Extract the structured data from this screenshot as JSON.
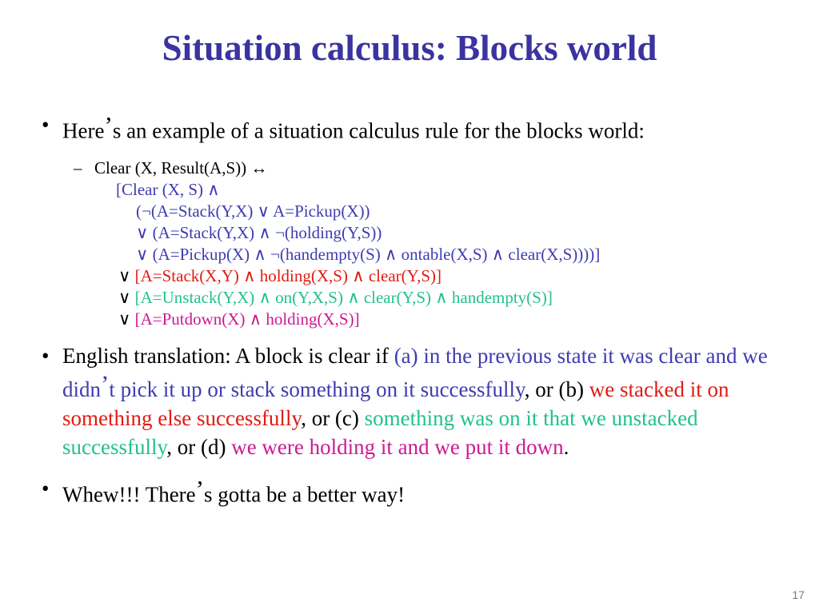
{
  "slide": {
    "title": "Situation calculus: Blocks world",
    "page_number": "17",
    "colors": {
      "title": "#3a33a0",
      "blue": "#3f3cb0",
      "red": "#e01b12",
      "green": "#24c08d",
      "magenta": "#cc1a92",
      "black": "#000000",
      "page_number": "#7a7a7a",
      "background": "#ffffff"
    },
    "bullet_marker": "•",
    "dash_marker": "–",
    "apostrophe": "’"
  },
  "bullet1": {
    "text_before_apos": "Here",
    "text_after_apos": "s an example of a situation calculus rule for the blocks world:"
  },
  "formula": {
    "head": "Clear (X, Result(A,S)) ↔",
    "lines": [
      {
        "indent": "ind-1",
        "op": "",
        "body": "[Clear (X, S) ∧",
        "color": "c-blue"
      },
      {
        "indent": "ind-2",
        "op": "",
        "body": "(¬(A=Stack(Y,X) ∨ A=Pickup(X))",
        "color": "c-blue"
      },
      {
        "indent": "ind-2",
        "op": "",
        "body": "∨ (A=Stack(Y,X) ∧ ¬(holding(Y,S))",
        "color": "c-blue"
      },
      {
        "indent": "ind-2",
        "op": "",
        "body": "∨ (A=Pickup(X) ∧ ¬(handempty(S) ∧ ontable(X,S) ∧ clear(X,S))))]",
        "color": "c-blue"
      },
      {
        "indent": "ind-3",
        "op": "∨ ",
        "body": "[A=Stack(X,Y) ∧ holding(X,S) ∧ clear(Y,S)]",
        "color": "c-red"
      },
      {
        "indent": "ind-3",
        "op": "∨ ",
        "body": "[A=Unstack(Y,X) ∧ on(Y,X,S) ∧ clear(Y,S) ∧ handempty(S)]",
        "color": "c-green"
      },
      {
        "indent": "ind-3",
        "op": "∨ ",
        "body": "[A=Putdown(X) ∧ holding(X,S)]",
        "color": "c-magenta"
      }
    ]
  },
  "bullet2": {
    "segments": [
      {
        "text": "English translation: A block is clear if ",
        "color": "c-black"
      },
      {
        "text": "(a) in the previous state it was clear and we didn",
        "color": "c-blue"
      },
      {
        "text": "’",
        "color": "c-blue",
        "apos": true
      },
      {
        "text": "t pick it up or stack something on it successfully",
        "color": "c-blue"
      },
      {
        "text": ", or (b) ",
        "color": "c-black"
      },
      {
        "text": "we stacked it on something else successfully",
        "color": "c-red"
      },
      {
        "text": ", or (c) ",
        "color": "c-black"
      },
      {
        "text": "something was on it that we unstacked successfully",
        "color": "c-green"
      },
      {
        "text": ", or (d) ",
        "color": "c-black"
      },
      {
        "text": "we were holding it and we put it down",
        "color": "c-magenta"
      },
      {
        "text": ".",
        "color": "c-black"
      }
    ]
  },
  "bullet3": {
    "text_before_apos": "Whew!!! There",
    "text_after_apos": "s gotta be a better way!"
  }
}
